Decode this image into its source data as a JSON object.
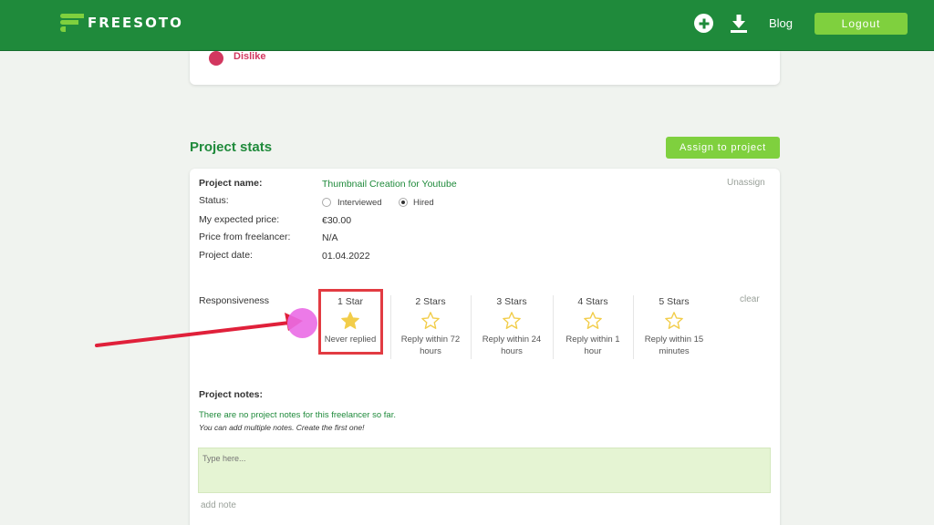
{
  "header": {
    "logo_text": "FREESOTO",
    "blog_label": "Blog",
    "logout_label": "Logout"
  },
  "feedback": {
    "dislike_label": "Dislike"
  },
  "section": {
    "title": "Project stats",
    "assign_label": "Assign to project"
  },
  "project": {
    "name_label": "Project name:",
    "name_value": "Thumbnail Creation for Youtube",
    "unassign_label": "Unassign",
    "status_label": "Status:",
    "status_options": [
      {
        "label": "Interviewed",
        "checked": false
      },
      {
        "label": "Hired",
        "checked": true
      }
    ],
    "expected_price_label": "My expected price:",
    "expected_price_value": "€30.00",
    "freelancer_price_label": "Price from freelancer:",
    "freelancer_price_value": "N/A",
    "date_label": "Project date:",
    "date_value": "01.04.2022"
  },
  "responsiveness": {
    "label": "Responsiveness",
    "clear_label": "clear",
    "selected": 1,
    "options": [
      {
        "title": "1 Star",
        "desc": "Never replied",
        "filled": true
      },
      {
        "title": "2 Stars",
        "desc": "Reply within 72 hours",
        "filled": false
      },
      {
        "title": "3 Stars",
        "desc": "Reply within 24 hours",
        "filled": false
      },
      {
        "title": "4 Stars",
        "desc": "Reply within 1 hour",
        "filled": false
      },
      {
        "title": "5 Stars",
        "desc": "Reply within 15 minutes",
        "filled": false
      }
    ]
  },
  "notes": {
    "title": "Project notes:",
    "empty_text": "There are no project notes for this freelancer so far.",
    "hint_text": "You can add multiple notes. Create the first one!",
    "placeholder": "Type here...",
    "add_label": "add note"
  },
  "colors": {
    "brand_green": "#1f8a3b",
    "accent_green": "#7fd03e",
    "star_yellow": "#f2cd4a",
    "highlight_red": "#e23b42",
    "cursor_pink": "#ea6be6"
  },
  "icons": {
    "add": "plus-circle-icon",
    "download": "download-icon",
    "star": "star-icon"
  }
}
